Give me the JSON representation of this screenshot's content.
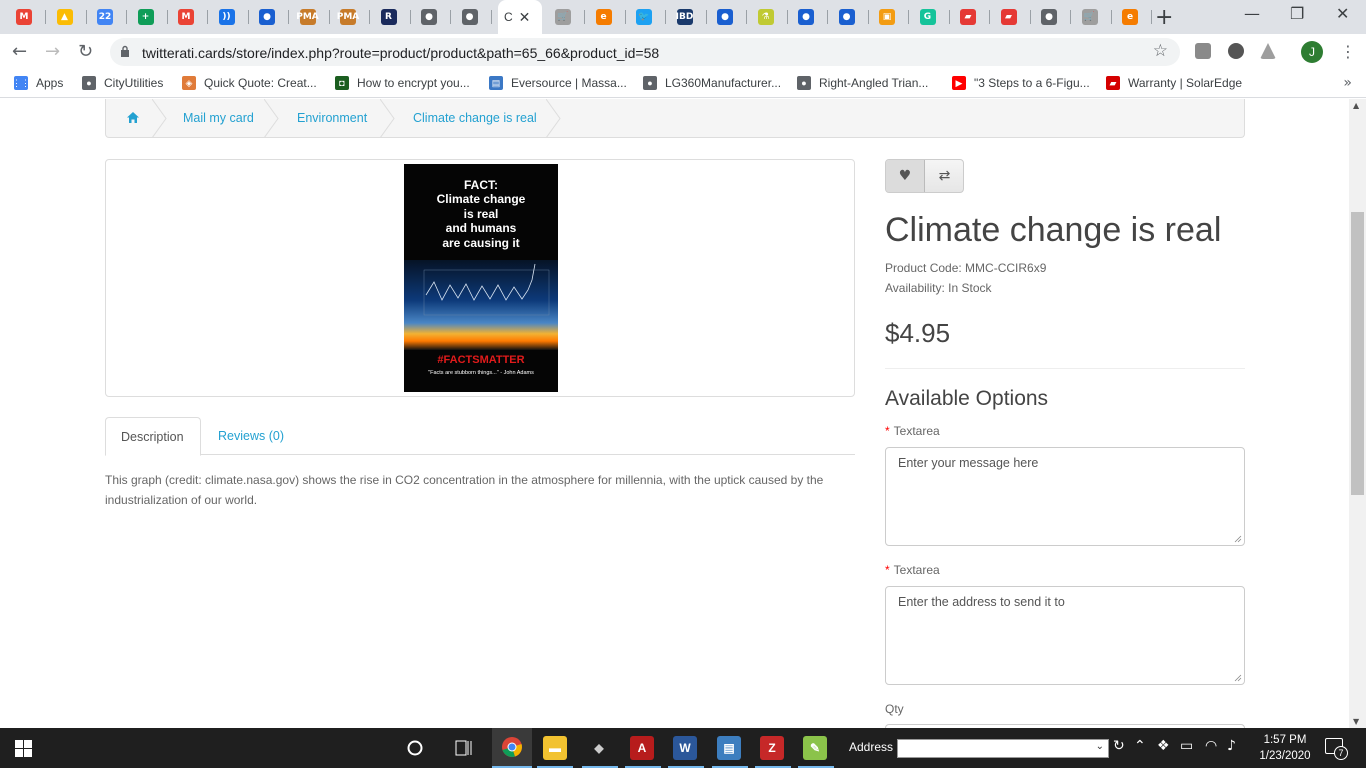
{
  "browser": {
    "tabs": [
      {
        "icon": "gmail-icon",
        "glyph": "M",
        "color": "#ea4335"
      },
      {
        "icon": "drive-icon",
        "glyph": "▲",
        "color": "#fbbc04"
      },
      {
        "icon": "calendar-icon",
        "glyph": "22",
        "color": "#4285f4"
      },
      {
        "icon": "sheets-plus-icon",
        "glyph": "+",
        "color": "#0f9d58"
      },
      {
        "icon": "gmail-icon",
        "glyph": "M",
        "color": "#ea4335"
      },
      {
        "icon": "radio-icon",
        "glyph": "))",
        "color": "#1a73e8"
      },
      {
        "icon": "blue-globe-icon",
        "glyph": "●",
        "color": "#1a5fd0"
      },
      {
        "icon": "pma-icon",
        "glyph": "PMA",
        "color": "#c77b2a"
      },
      {
        "icon": "pma-icon",
        "glyph": "PMA",
        "color": "#c77b2a"
      },
      {
        "icon": "r-icon",
        "glyph": "R",
        "color": "#1a2a5c"
      },
      {
        "icon": "globe-icon",
        "glyph": "●",
        "color": "#5f6368"
      },
      {
        "icon": "globe-icon",
        "glyph": "●",
        "color": "#5f6368"
      }
    ],
    "active_tab_title": "C",
    "tabs_right": [
      {
        "icon": "cart-icon",
        "glyph": "🛒",
        "color": "#9e9e9e"
      },
      {
        "icon": "orange-e-icon",
        "glyph": "e",
        "color": "#f57c00"
      },
      {
        "icon": "twitter-icon",
        "glyph": "🐦",
        "color": "#1da1f2"
      },
      {
        "icon": "ibd-icon",
        "glyph": "IBD",
        "color": "#1a3a6c"
      },
      {
        "icon": "blue-globe-icon",
        "glyph": "●",
        "color": "#1a5fd0"
      },
      {
        "icon": "flask-icon",
        "glyph": "⚗",
        "color": "#c0ca33"
      },
      {
        "icon": "blue-globe-icon",
        "glyph": "●",
        "color": "#1a5fd0"
      },
      {
        "icon": "blue-globe-icon",
        "glyph": "●",
        "color": "#1a5fd0"
      },
      {
        "icon": "orange-box-icon",
        "glyph": "▣",
        "color": "#f39c12"
      },
      {
        "icon": "grammarly-icon",
        "glyph": "G",
        "color": "#15c39a"
      },
      {
        "icon": "red-tag-icon",
        "glyph": "▰",
        "color": "#e53935"
      },
      {
        "icon": "red-tag-icon",
        "glyph": "▰",
        "color": "#e53935"
      },
      {
        "icon": "globe-icon",
        "glyph": "●",
        "color": "#5f6368"
      },
      {
        "icon": "cart-icon",
        "glyph": "🛒",
        "color": "#9e9e9e"
      },
      {
        "icon": "orange-e-icon",
        "glyph": "e",
        "color": "#f57c00"
      }
    ],
    "url": "twitterati.cards/store/index.php?route=product/product&path=65_66&product_id=58",
    "profile_initial": "J",
    "bookmarks": [
      {
        "label": "Apps",
        "icon": "apps-grid-icon",
        "color": "#4285f4",
        "glyph": "⋮⋮"
      },
      {
        "label": "CityUtilities",
        "icon": "globe-icon",
        "color": "#5f6368",
        "glyph": "●"
      },
      {
        "label": "Quick Quote: Creat...",
        "icon": "leaf-icon",
        "color": "#e07b39",
        "glyph": "◈"
      },
      {
        "label": "How to encrypt you...",
        "icon": "green-doc-icon",
        "color": "#1b5e20",
        "glyph": "◘"
      },
      {
        "label": "Eversource | Massa...",
        "icon": "doc-icon",
        "color": "#3b78c5",
        "glyph": "▤"
      },
      {
        "label": "LG360Manufacturer...",
        "icon": "globe-icon",
        "color": "#5f6368",
        "glyph": "●"
      },
      {
        "label": "Right-Angled Trian...",
        "icon": "globe-icon",
        "color": "#5f6368",
        "glyph": "●"
      },
      {
        "label": "\"3 Steps to a 6-Figu...",
        "icon": "youtube-icon",
        "color": "#ff0000",
        "glyph": "▶"
      },
      {
        "label": "Warranty | SolarEdge",
        "icon": "solaredge-icon",
        "color": "#d50000",
        "glyph": "▰"
      }
    ]
  },
  "store": {
    "breadcrumb": [
      "Mail my card",
      "Environment",
      "Climate change is real"
    ],
    "poster": {
      "lines": [
        "FACT:",
        "Climate change",
        "is real",
        "and humans",
        "are causing it"
      ],
      "hashtag": "#FACTSMATTER",
      "quote": "\"Facts are stubborn things...\"  - John Adams"
    },
    "tabs": {
      "description": "Description",
      "reviews": "Reviews (0)"
    },
    "description": "This graph (credit:  climate.nasa.gov) shows the rise in CO2 concentration in the atmosphere for millennia, with the uptick caused by the industrialization of our world.",
    "product": {
      "title": "Climate change is real",
      "code": "Product Code: MMC-CCIR6x9",
      "availability": "Availability: In Stock",
      "price": "$4.95"
    },
    "options": {
      "heading": "Available Options",
      "required_mark": "*",
      "field1_label": "Textarea",
      "field1_placeholder": "Enter your message here",
      "field2_label": "Textarea",
      "field2_placeholder": "Enter the address to send it to",
      "qty_label": "Qty"
    }
  },
  "taskbar": {
    "address_label": "Address",
    "time": "1:57 PM",
    "date": "1/23/2020",
    "notifications": "7"
  }
}
